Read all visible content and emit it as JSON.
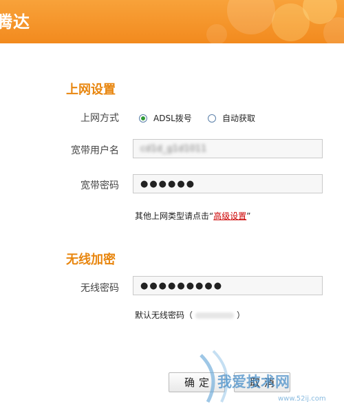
{
  "header": {
    "brand": "腾达"
  },
  "internet": {
    "title": "上网设置",
    "mode_label": "上网方式",
    "options": [
      "ADSL拨号",
      "自动获取"
    ],
    "selected": "ADSL拨号",
    "username_label": "宽带用户名",
    "username_value": "cd1d_g1d1011",
    "password_label": "宽带密码",
    "password_mask": "●●●●●●",
    "hint_prefix": "其他上网类型请点击“",
    "hint_link": "高级设置",
    "hint_suffix": "”"
  },
  "wireless": {
    "title": "无线加密",
    "password_label": "无线密码",
    "password_mask": "●●●●●●●●●",
    "default_prefix": "默认无线密码（",
    "default_suffix": "）"
  },
  "buttons": {
    "confirm": "确定",
    "cancel": "取消"
  },
  "watermark": {
    "text": "我爱技术网",
    "url": "www.52ij.com"
  },
  "colors": {
    "header": "#f28a1e",
    "section_title": "#e8860f",
    "link": "#cc0000",
    "radio_dot": "#2f9a35"
  }
}
